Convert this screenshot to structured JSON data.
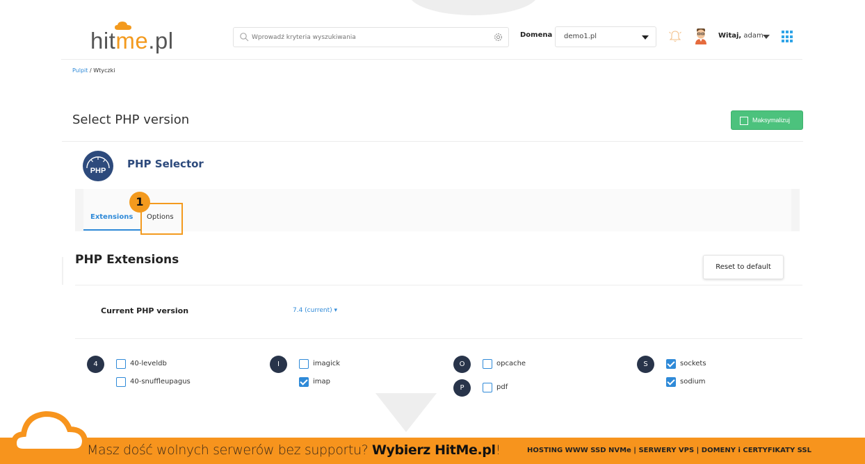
{
  "header": {
    "logo_prefix": "hit",
    "logo_me": "me",
    "logo_suffix": ".pl",
    "search_placeholder": "Wprowadź kryteria wyszukiwania",
    "domain_label": "Domena",
    "domain_value": "demo1.pl",
    "greeting_bold": "Witaj,",
    "greeting_user": " adam"
  },
  "breadcrumb": {
    "link": "Pulpit",
    "current": " / Wtyczki"
  },
  "page": {
    "title": "Select PHP version",
    "maximize_label": "Maksymalizuj"
  },
  "php_selector": {
    "logo_text": "PHP",
    "title": "PHP Selector",
    "tabs": [
      {
        "label": "Extensions",
        "active": true
      },
      {
        "label": "Options",
        "active": false
      }
    ],
    "step_badge": "1"
  },
  "extensions": {
    "title": "PHP Extensions",
    "reset_label": "Reset to default",
    "current_version_label": "Current PHP version",
    "current_version_value": "7.4 (current) ▾",
    "groups": [
      {
        "letter": "4",
        "items": [
          {
            "name": "40-leveldb",
            "checked": false
          },
          {
            "name": "40-snuffleupagus",
            "checked": false
          }
        ]
      },
      {
        "letter": "I",
        "items": [
          {
            "name": "imagick",
            "checked": false
          },
          {
            "name": "imap",
            "checked": true
          }
        ]
      },
      {
        "letter": "O",
        "items": [
          {
            "name": "opcache",
            "checked": false
          }
        ]
      },
      {
        "letter": "P",
        "items": [
          {
            "name": "pdf",
            "checked": false
          }
        ]
      },
      {
        "letter": "S",
        "items": [
          {
            "name": "sockets",
            "checked": true
          },
          {
            "name": "sodium",
            "checked": true
          }
        ]
      }
    ]
  },
  "footer": {
    "message": "Masz dość wolnych serwerów bez supportu? ",
    "message_bold": "Wybierz HitMe.pl",
    "message_end": "!",
    "services": "HOSTING WWW SSD NVMe | SERWERY VPS | DOMENY i CERTYFIKATY SSL"
  },
  "colors": {
    "accent_orange": "#f7941d",
    "link_blue": "#2f8ad8",
    "maximize_green": "#4cc27d",
    "php_navy": "#2d4a7c"
  }
}
